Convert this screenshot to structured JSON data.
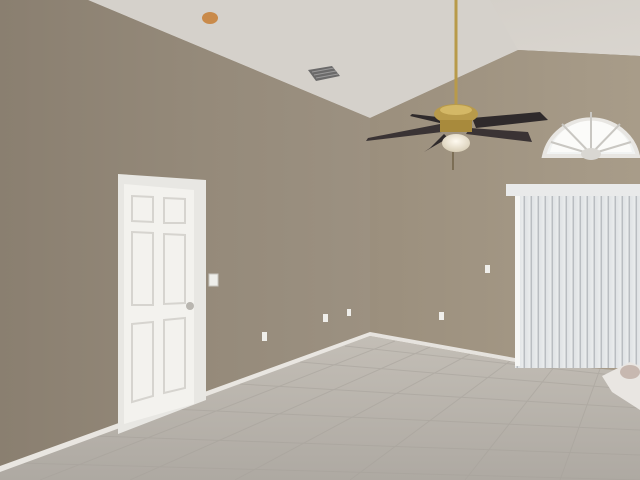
{
  "scene": {
    "subject": "empty-room-interior",
    "objects": [
      "vaulted-ceiling",
      "ceiling-fan",
      "ceiling-vent",
      "smoke-detector",
      "interior-door",
      "vertical-blinds",
      "arched-window",
      "tile-floor",
      "baseboard",
      "light-switch",
      "electrical-outlet"
    ]
  },
  "colors": {
    "ceiling": "#d8d4ce",
    "wall_left": "#8e8373",
    "wall_back": "#a19582",
    "door": "#f1f0ec",
    "floor": "#bcb7b0",
    "blinds": "#e4e6e8",
    "fan_brass": "#b89a4a",
    "fan_blade": "#2f2a2b"
  }
}
